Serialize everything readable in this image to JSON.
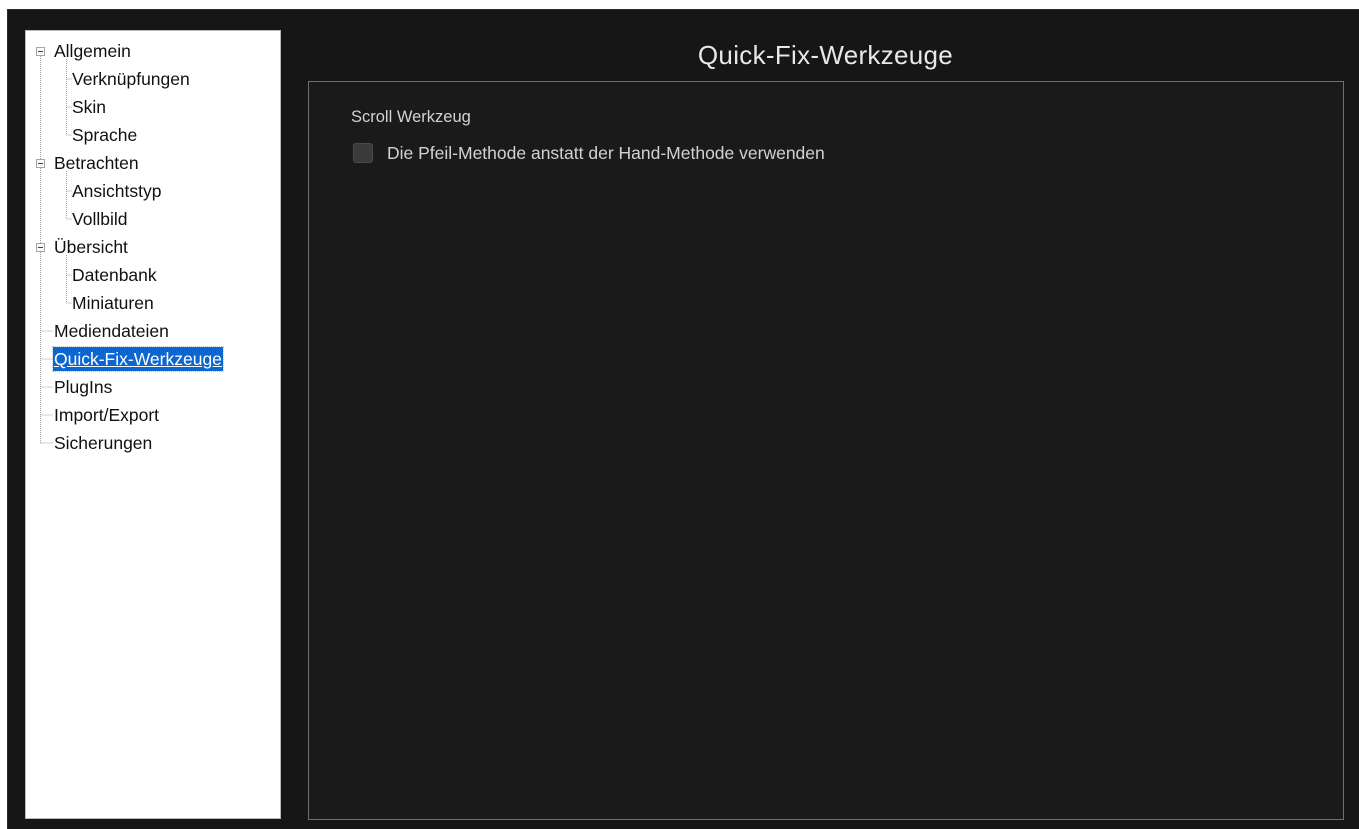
{
  "sidebar": {
    "items": [
      {
        "label": "Allgemein",
        "level": 0,
        "expandable": true,
        "expanded": true,
        "selected": false
      },
      {
        "label": "Verknüpfungen",
        "level": 1,
        "selected": false
      },
      {
        "label": "Skin",
        "level": 1,
        "selected": false
      },
      {
        "label": "Sprache",
        "level": 1,
        "selected": false
      },
      {
        "label": "Betrachten",
        "level": 0,
        "expandable": true,
        "expanded": true,
        "selected": false
      },
      {
        "label": "Ansichtstyp",
        "level": 1,
        "selected": false
      },
      {
        "label": "Vollbild",
        "level": 1,
        "selected": false
      },
      {
        "label": "Übersicht",
        "level": 0,
        "expandable": true,
        "expanded": true,
        "selected": false
      },
      {
        "label": "Datenbank",
        "level": 1,
        "selected": false
      },
      {
        "label": "Miniaturen",
        "level": 1,
        "selected": false
      },
      {
        "label": "Mediendateien",
        "level": 0,
        "expandable": false,
        "selected": false
      },
      {
        "label": "Quick-Fix-Werkzeuge",
        "level": 0,
        "expandable": false,
        "selected": true
      },
      {
        "label": "PlugIns",
        "level": 0,
        "expandable": false,
        "selected": false
      },
      {
        "label": "Import/Export",
        "level": 0,
        "expandable": false,
        "selected": false
      },
      {
        "label": "Sicherungen",
        "level": 0,
        "expandable": false,
        "selected": false
      }
    ]
  },
  "main": {
    "title": "Quick-Fix-Werkzeuge",
    "group_label": "Scroll Werkzeug",
    "option": {
      "label": "Die Pfeil-Methode anstatt der Hand-Methode verwenden",
      "checked": false
    }
  },
  "colors": {
    "background": "#161616",
    "selection": "#0b66d0",
    "text_light": "#d2d2d2"
  }
}
